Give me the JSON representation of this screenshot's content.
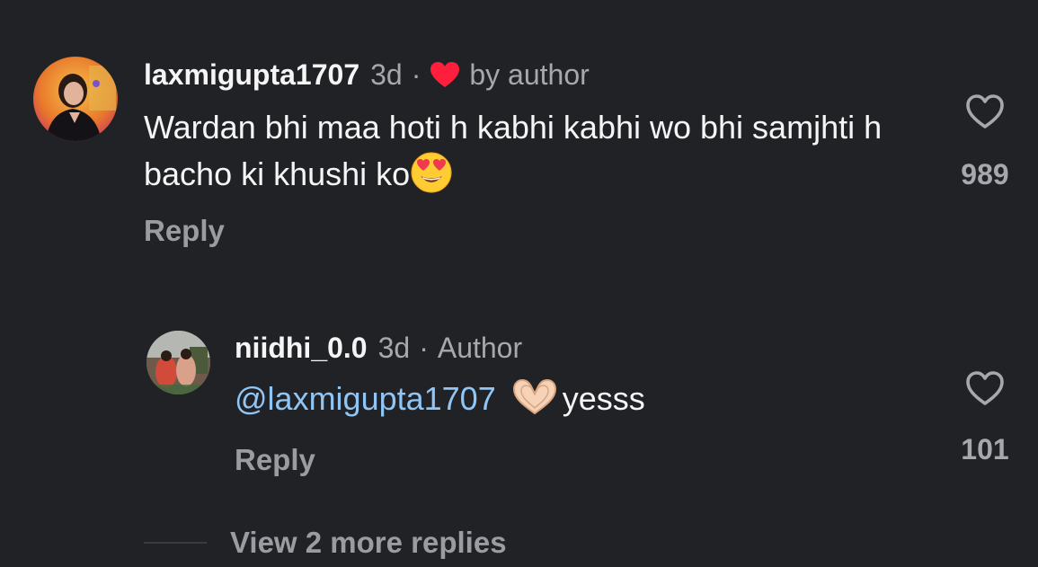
{
  "comment": {
    "username": "laxmigupta1707",
    "time": "3d",
    "separator": "·",
    "liked_by_label": "by author",
    "text": "Wardan bhi maa hoti h kabhi kabhi wo bhi samjhti h bacho ki khushi ko",
    "emoji": "heart-eyes-emoji",
    "reply_label": "Reply",
    "like_count": "989"
  },
  "reply": {
    "username": "niidhi_0.0",
    "time": "3d",
    "separator": "·",
    "author_label": "Author",
    "mention": "@laxmigupta1707",
    "emoji": "heart-hands-emoji",
    "text": "yesss",
    "reply_label": "Reply",
    "like_count": "101"
  },
  "view_more": "View 2 more replies",
  "colors": {
    "background": "#212226",
    "text": "#f5f5f5",
    "muted": "#a6a8ae",
    "mention": "#8fc6f5",
    "heart_badge": "#ff1f3d"
  }
}
